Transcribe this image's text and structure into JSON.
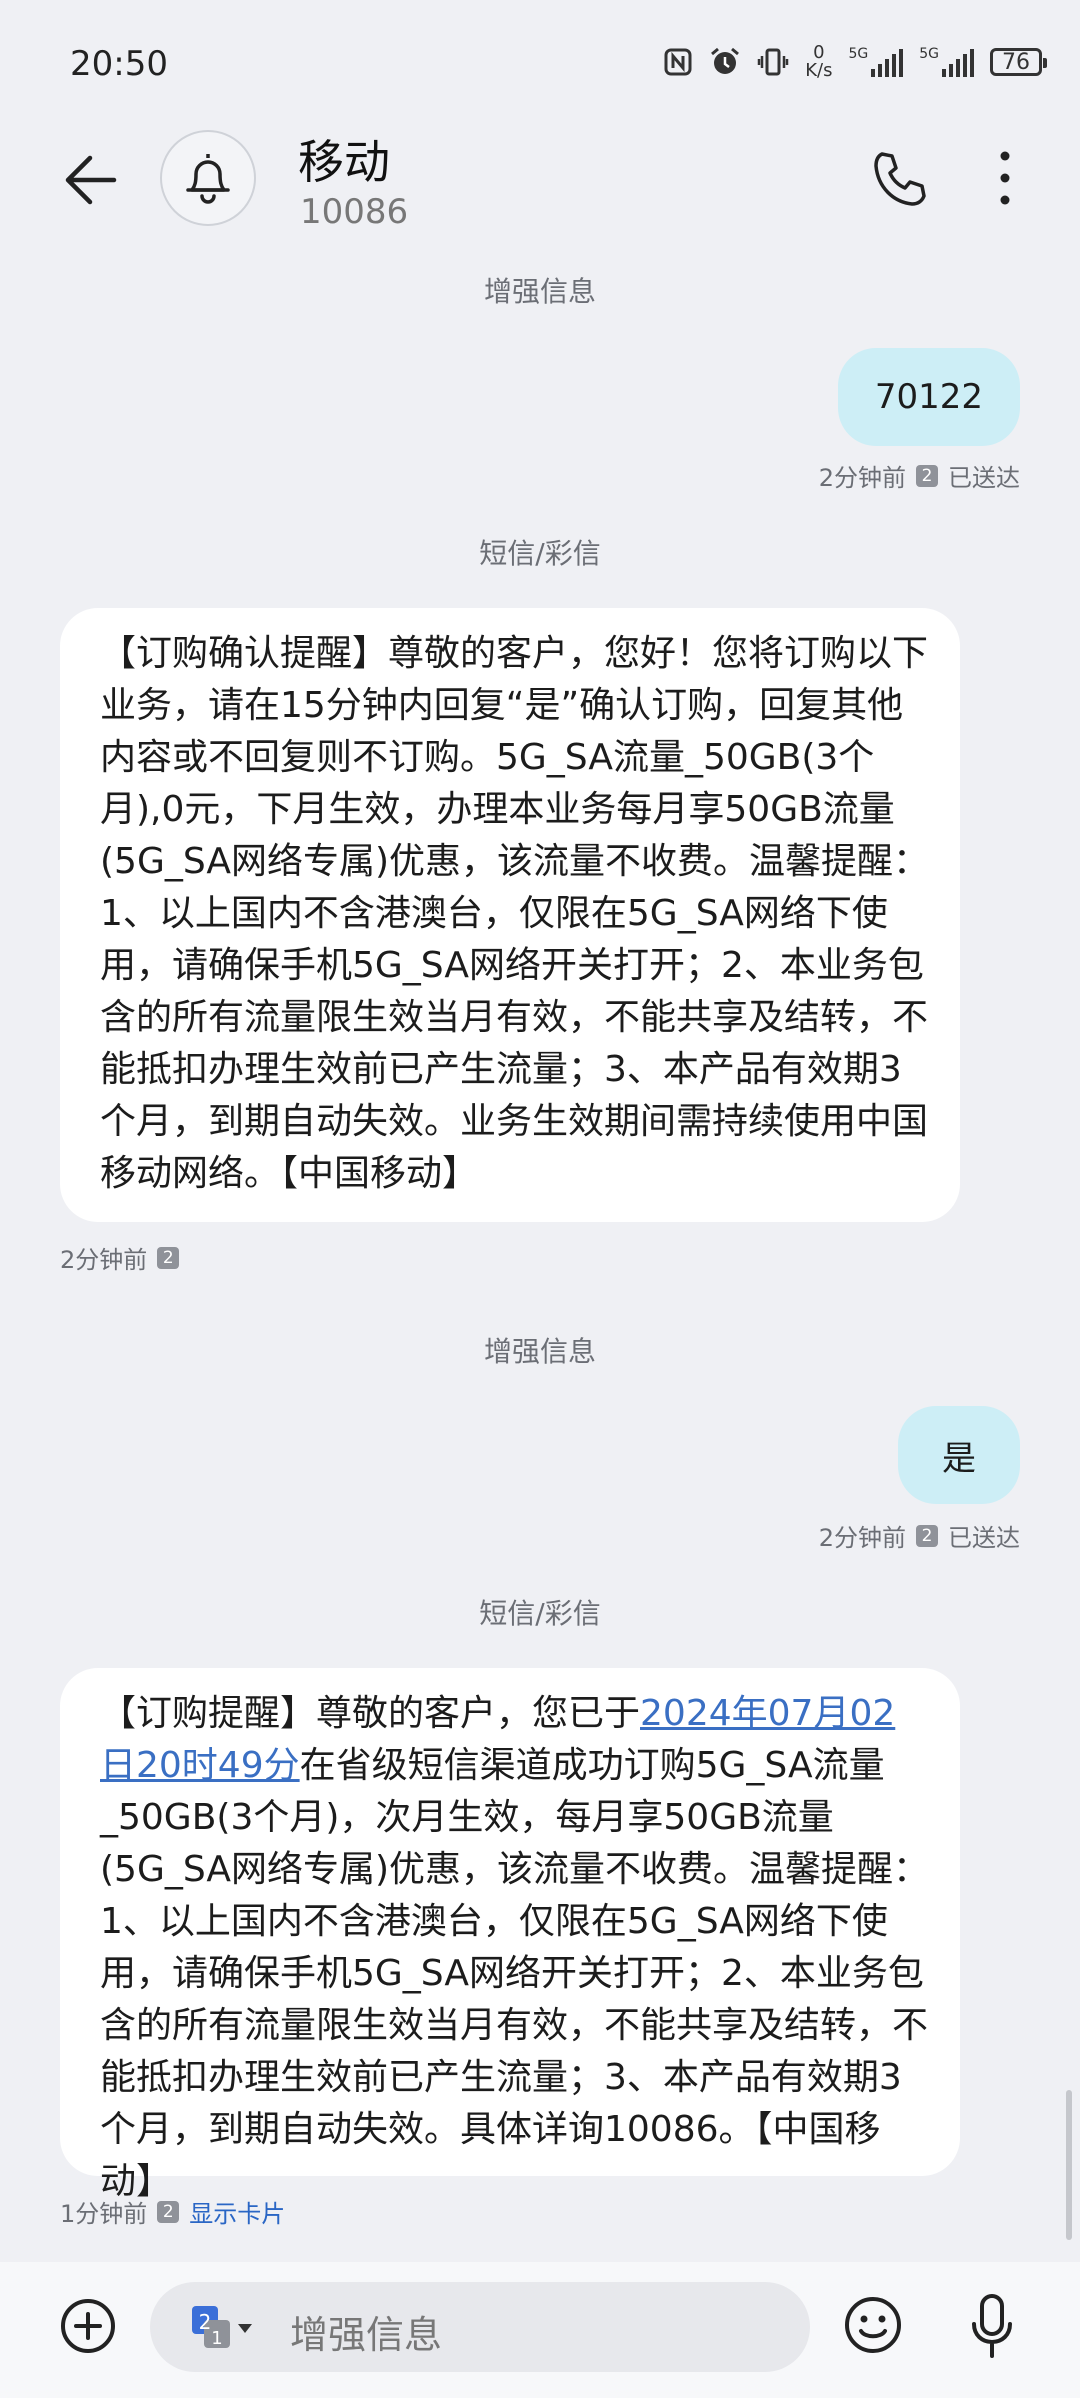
{
  "status_bar": {
    "time": "20:50",
    "net_speed_value": "0",
    "net_speed_unit": "K/s",
    "sim1_tech": "5G",
    "sim2_tech": "5G",
    "battery": "76"
  },
  "header": {
    "name": "移动",
    "number": "10086"
  },
  "messages": {
    "label1": "增强信息",
    "out1": {
      "text": "70122",
      "time": "2分钟前",
      "sim": "2",
      "status": "已送达"
    },
    "label2": "短信/彩信",
    "in1": {
      "text": "【订购确认提醒】尊敬的客户，您好！您将订购以下业务，请在15分钟内回复“是”确认订购，回复其他内容或不回复则不订购。5G_SA流量_50GB(3个月),0元，下月生效，办理本业务每月享50GB流量(5G_SA网络专属)优惠，该流量不收费。温馨提醒：1、以上国内不含港澳台，仅限在5G_SA网络下使用，请确保手机5G_SA网络开关打开；2、本业务包含的所有流量限生效当月有效，不能共享及结转，不能抵扣办理生效前已产生流量；3、本产品有效期3个月，到期自动失效。业务生效期间需持续使用中国移动网络。【中国移动】",
      "time": "2分钟前",
      "sim": "2"
    },
    "label3": "增强信息",
    "out2": {
      "text": "是",
      "time": "2分钟前",
      "sim": "2",
      "status": "已送达"
    },
    "label4": "短信/彩信",
    "in2": {
      "text_before": "【订购提醒】尊敬的客户，您已于",
      "link": "2024年07月02日20时49分",
      "text_after": "在省级短信渠道成功订购5G_SA流量_50GB(3个月)，次月生效，每月享50GB流量(5G_SA网络专属)优惠，该流量不收费。温馨提醒：1、以上国内不含港澳台，仅限在5G_SA网络下使用，请确保手机5G_SA网络开关打开；2、本业务包含的所有流量限生效当月有效，不能共享及结转，不能抵扣办理生效前已产生流量；3、本产品有效期3个月，到期自动失效。具体详询10086。【中国移动】",
      "time": "1分钟前",
      "sim": "2",
      "action": "显示卡片"
    }
  },
  "input": {
    "placeholder": "增强信息",
    "sim_primary": "2",
    "sim_secondary": "1"
  }
}
